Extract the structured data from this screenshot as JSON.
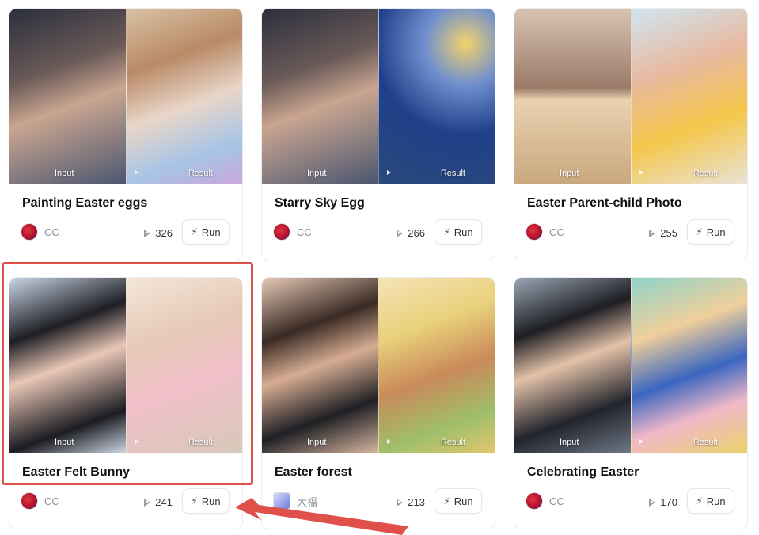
{
  "cards": [
    {
      "title": "Painting Easter eggs",
      "author": "CC",
      "plays": "326",
      "run_label": "Run",
      "input_label": "Input",
      "result_label": "Result",
      "avatar": "red-mask"
    },
    {
      "title": "Starry Sky Egg",
      "author": "CC",
      "plays": "266",
      "run_label": "Run",
      "input_label": "Input",
      "result_label": "Result",
      "avatar": "red-mask"
    },
    {
      "title": "Easter Parent-child Photo",
      "author": "CC",
      "plays": "255",
      "run_label": "Run",
      "input_label": "Input",
      "result_label": "Result",
      "avatar": "red-mask"
    },
    {
      "title": "Easter Felt Bunny",
      "author": "CC",
      "plays": "241",
      "run_label": "Run",
      "input_label": "Input",
      "result_label": "Result",
      "avatar": "red-mask"
    },
    {
      "title": "Easter forest",
      "author": "大福",
      "plays": "213",
      "run_label": "Run",
      "input_label": "Input",
      "result_label": "Result",
      "avatar": "pixel-character"
    },
    {
      "title": "Celebrating Easter",
      "author": "CC",
      "plays": "170",
      "run_label": "Run",
      "input_label": "Input",
      "result_label": "Result",
      "avatar": "red-mask"
    }
  ],
  "icons": {
    "run": "magic-wand-icon",
    "plays": "play-icon"
  },
  "colors": {
    "highlight": "#e0504a",
    "border": "#ececef",
    "muted_text": "#8a8f98"
  }
}
